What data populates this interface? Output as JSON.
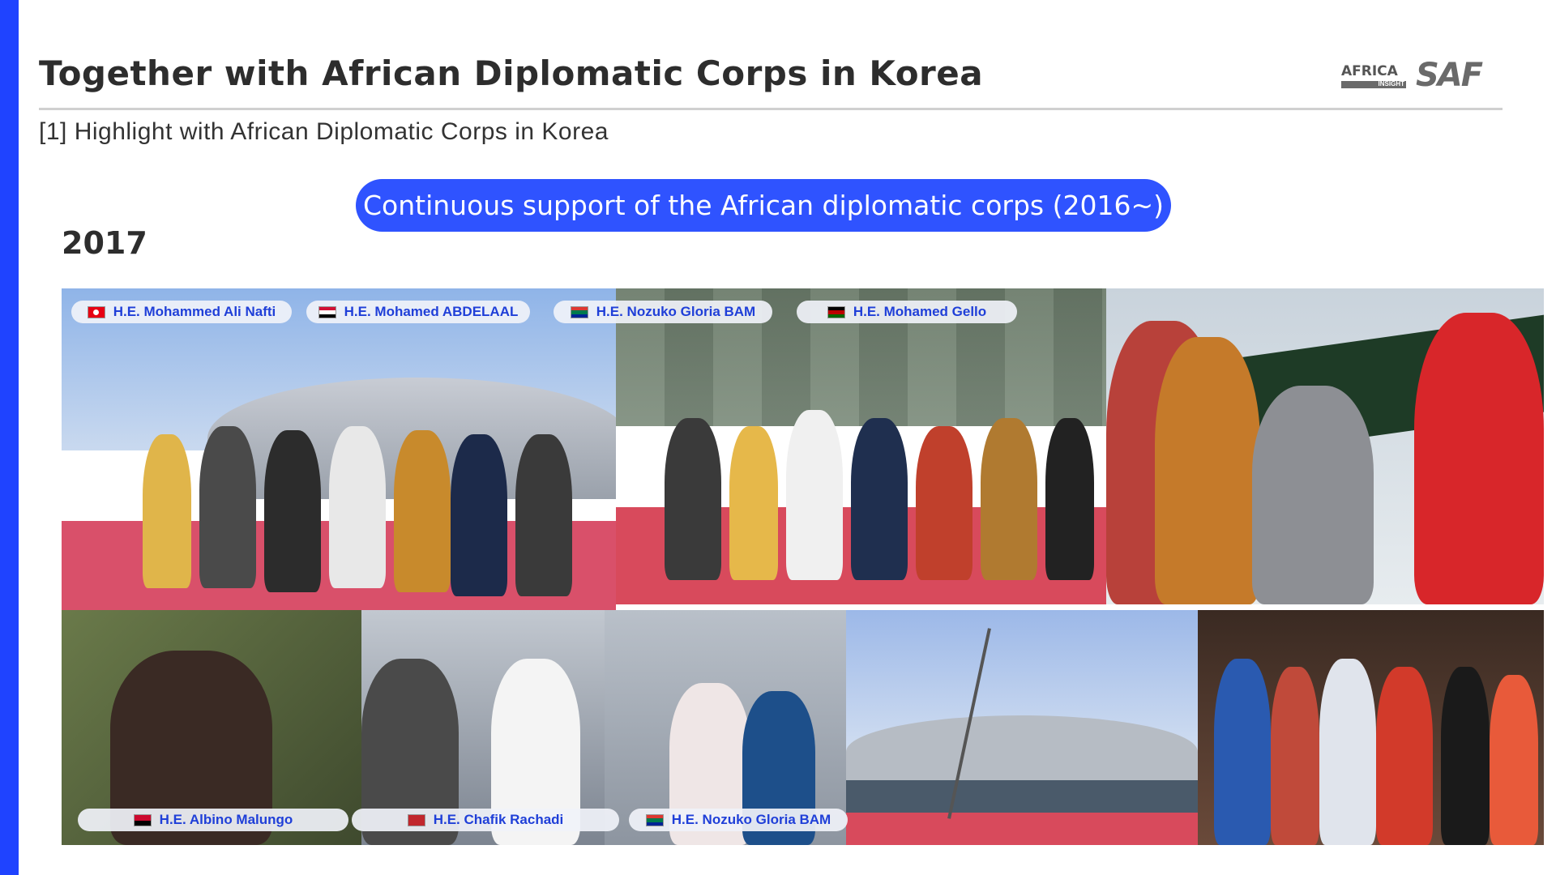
{
  "header": {
    "title": "Together with African Diplomatic Corps in Korea",
    "subtitle": "[1] Highlight with African Diplomatic Corps in Korea",
    "logo_africa_main": "AFRICA",
    "logo_africa_sub": "INSIGHT",
    "logo_saf": "SAF"
  },
  "banner": {
    "text": "Continuous support of the African diplomatic corps (2016~)"
  },
  "year": "2017",
  "labels": [
    {
      "name": "H.E. Mohammed Ali Nafti",
      "flag": "tunisia"
    },
    {
      "name": "H.E. Mohamed ABDELAAL",
      "flag": "sudan"
    },
    {
      "name": "H.E. Nozuko Gloria BAM",
      "flag": "south-africa"
    },
    {
      "name": "H.E. Mohamed Gello",
      "flag": "kenya"
    },
    {
      "name": "H.E. Albino Malungo",
      "flag": "angola"
    },
    {
      "name": "H.E. Chafik Rachadi",
      "flag": "morocco"
    },
    {
      "name": "H.E. Nozuko Gloria BAM",
      "flag": "south-africa"
    }
  ],
  "colors": {
    "accent": "#1f43ff",
    "banner": "#2f53ff",
    "label_text": "#1f3fd8"
  }
}
